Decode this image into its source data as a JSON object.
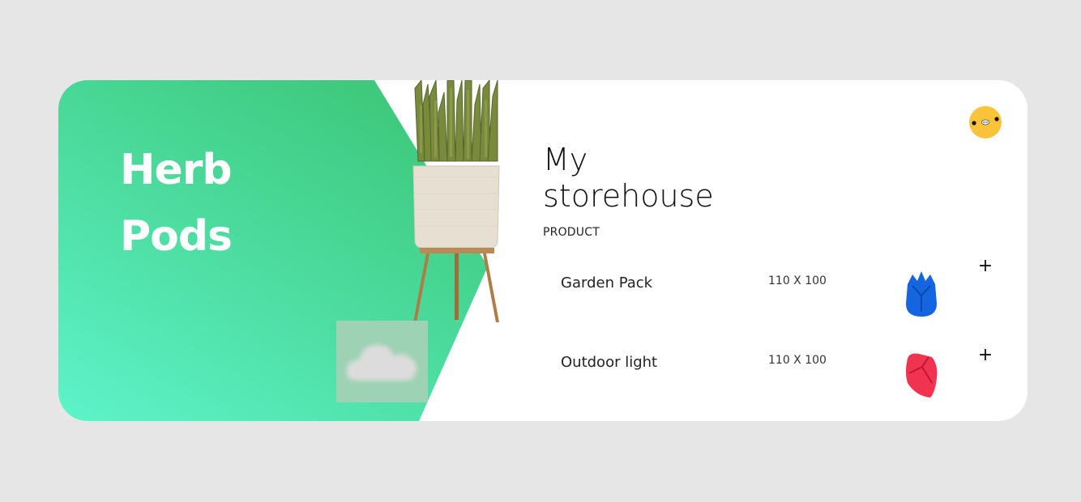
{
  "hero": {
    "title_line1": "Herb",
    "title_line2": "Pods",
    "gradient_start": "#3ec97c",
    "gradient_end": "#5df2c8"
  },
  "header": {
    "avatar_color": "#fbc33a",
    "avatar_icon": "emoji-face-icon"
  },
  "store": {
    "title_line1": "My",
    "title_line2": "storehouse",
    "section_label": "PRODUCT"
  },
  "products": [
    {
      "name": "Garden Pack",
      "size": "110 X 100",
      "thumb_icon": "blue-pod-icon",
      "thumb_color": "#1565e0",
      "add_label": "+"
    },
    {
      "name": "Outdoor light",
      "size": "110 X 100",
      "thumb_icon": "red-pod-icon",
      "thumb_color": "#f0334f",
      "add_label": "+"
    }
  ]
}
